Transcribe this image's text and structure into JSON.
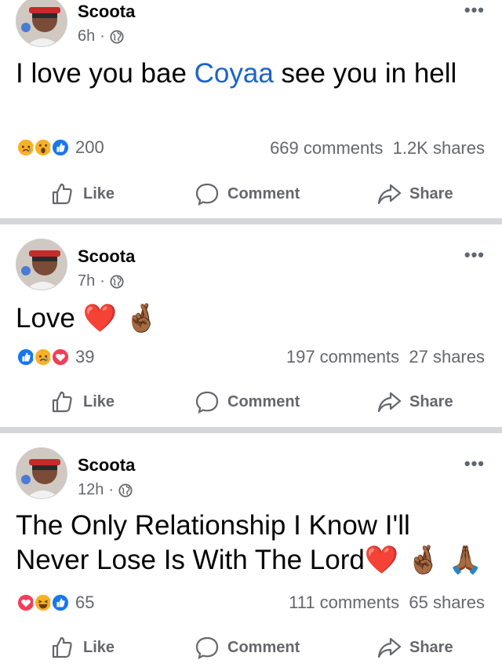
{
  "posts": [
    {
      "author": "Scoota",
      "time": "6h",
      "separator": "·",
      "text_before": "I love you bae ",
      "mention": "Coyaa",
      "text_after": " see you in hell",
      "reaction_count": "200",
      "reactions": [
        "sad",
        "wow",
        "like"
      ],
      "comments": "669 comments",
      "shares": "1.2K shares"
    },
    {
      "author": "Scoota",
      "time": "7h",
      "separator": "·",
      "text": "Love ❤️ 🤞🏾",
      "reaction_count": "39",
      "reactions": [
        "like",
        "sad",
        "love"
      ],
      "comments": "197 comments",
      "shares": "27 shares"
    },
    {
      "author": "Scoota",
      "time": "12h",
      "separator": "·",
      "text": "The Only Relationship I Know I'll Never Lose Is With The Lord❤️ 🤞🏾 🙏🏾",
      "reaction_count": "65",
      "reactions": [
        "love",
        "haha",
        "like"
      ],
      "comments": "111 comments",
      "shares": "65 shares"
    }
  ],
  "actions": {
    "like": "Like",
    "comment": "Comment",
    "share": "Share"
  },
  "more_label": "•••",
  "colors": {
    "mention": "#1b64c8",
    "like": "#1877f2",
    "love": "#f33e58",
    "sad": "#f7b125",
    "divider": "#d4d6da"
  }
}
